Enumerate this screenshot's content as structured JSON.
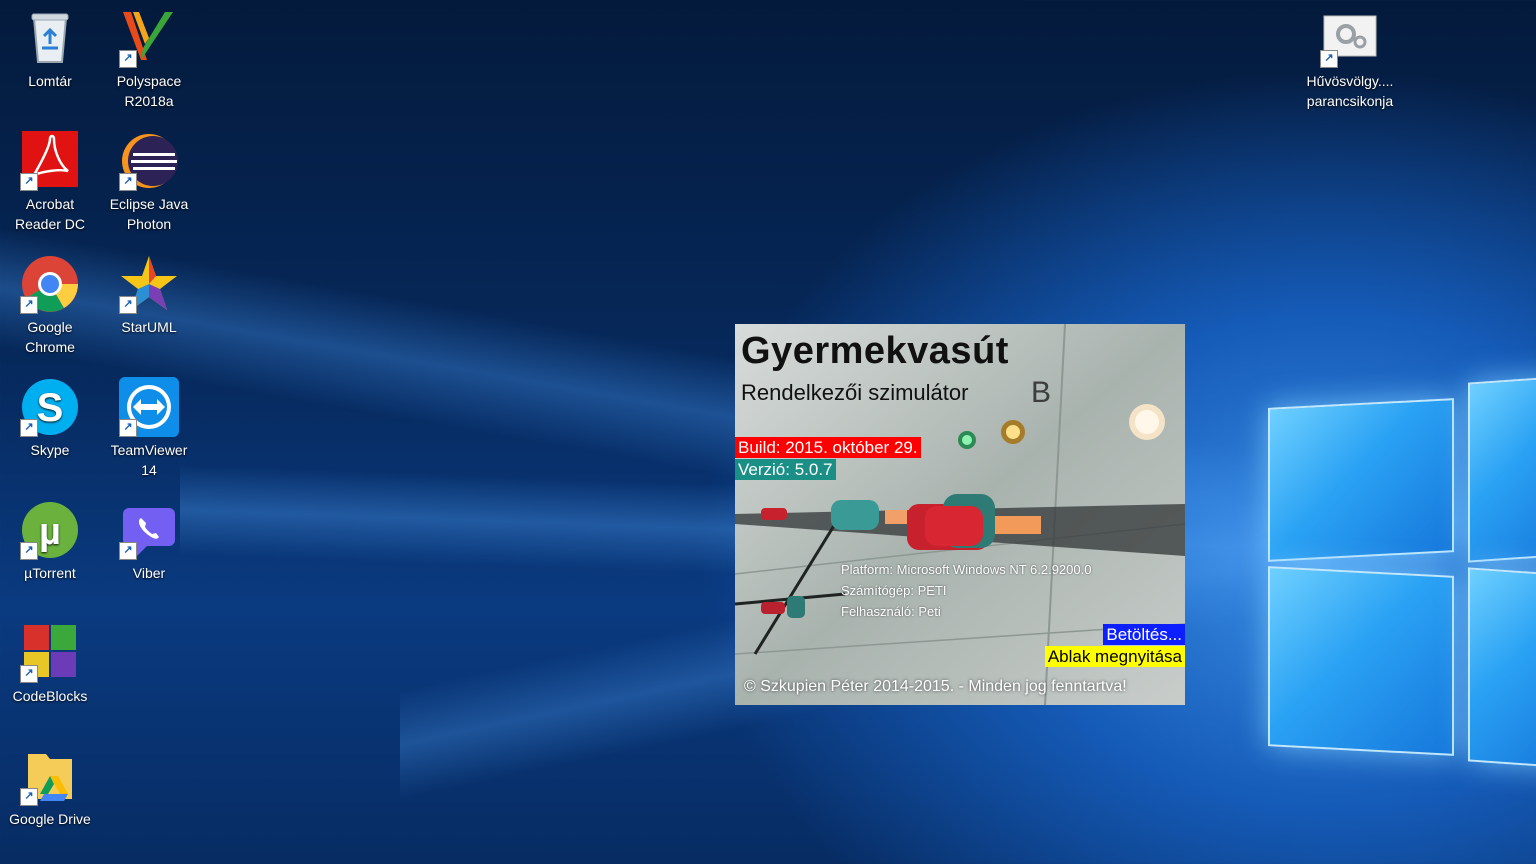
{
  "desktop": {
    "icons": [
      {
        "label": "Lomtár",
        "icon": "recycle-bin-icon"
      },
      {
        "label": "Polyspace\nR2018a",
        "icon": "polyspace-icon"
      },
      {
        "label": "Acrobat\nReader DC",
        "icon": "acrobat-icon"
      },
      {
        "label": "Eclipse Java\nPhoton",
        "icon": "eclipse-icon"
      },
      {
        "label": "Google\nChrome",
        "icon": "chrome-icon"
      },
      {
        "label": "StarUML",
        "icon": "staruml-icon"
      },
      {
        "label": "Skype",
        "icon": "skype-icon"
      },
      {
        "label": "TeamViewer\n14",
        "icon": "teamviewer-icon"
      },
      {
        "label": "µTorrent",
        "icon": "utorrent-icon"
      },
      {
        "label": "Viber",
        "icon": "viber-icon"
      },
      {
        "label": "CodeBlocks",
        "icon": "codeblocks-icon"
      },
      {
        "label": "Google Drive",
        "icon": "google-drive-icon"
      },
      {
        "label": "Hűvösvölgy....\nparancsikonja",
        "icon": "settings-shortcut-icon"
      }
    ],
    "shortcut_arrow": "↗"
  },
  "splash": {
    "title": "Gyermekvasút",
    "subtitle": "Rendelkezői szimulátor",
    "build": "Build: 2015. október 29.",
    "version": "Verzió: 5.0.7",
    "platform": "Platform: Microsoft Windows NT 6.2.9200.0",
    "computer": "Számítógép: PETI",
    "user": "Felhasználó: Peti",
    "status_loading": "Betöltés...",
    "status_opening": "Ablak megnyitása",
    "copyright": "© Szkupien Péter 2014-2015. - Minden jog fenntartva!",
    "panel_letter": "B",
    "colors": {
      "build_bg": "#ff0000",
      "version_bg": "#1a8f86",
      "loading_bg": "#0b1fff",
      "opening_bg": "#ffff00"
    }
  }
}
